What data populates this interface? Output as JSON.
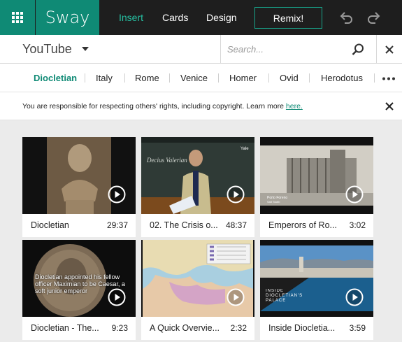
{
  "app": {
    "name": "Sway"
  },
  "nav": {
    "insert": "Insert",
    "cards": "Cards",
    "design": "Design",
    "remix": "Remix!"
  },
  "source": {
    "label": "YouTube",
    "search_placeholder": "Search..."
  },
  "tags": [
    "Diocletian",
    "Italy",
    "Rome",
    "Venice",
    "Homer",
    "Ovid",
    "Herodotus"
  ],
  "notice": {
    "text": "You are responsible for respecting others' rights, including copyright. Learn more ",
    "link": "here."
  },
  "videos": [
    {
      "title": "Diocletian",
      "duration": "29:37"
    },
    {
      "title": "02. The Crisis o...",
      "duration": "48:37"
    },
    {
      "title": "Emperors of Ro...",
      "duration": "3:02"
    },
    {
      "title": "Diocletian - The...",
      "duration": "9:23"
    },
    {
      "title": "A Quick Overvie...",
      "duration": "2:32"
    },
    {
      "title": "Inside Diocletia...",
      "duration": "3:59"
    }
  ],
  "thumb_text": {
    "v2_board": "Decius Valerian",
    "v2_corner": "Yale",
    "v3_caption_1": "Porto Foreno",
    "v3_caption_2": "Salt Stubb",
    "v4_overlay": "Diocletian appointed his fellow officer Maximian to be Caesar, a soft junior emperor",
    "v6_overlay": "INSIDE DIOCLETIAN'S PALACE"
  },
  "colors": {
    "brand": "#0f8a75",
    "accent": "#26c0a2",
    "topbar": "#1e1e1e"
  }
}
